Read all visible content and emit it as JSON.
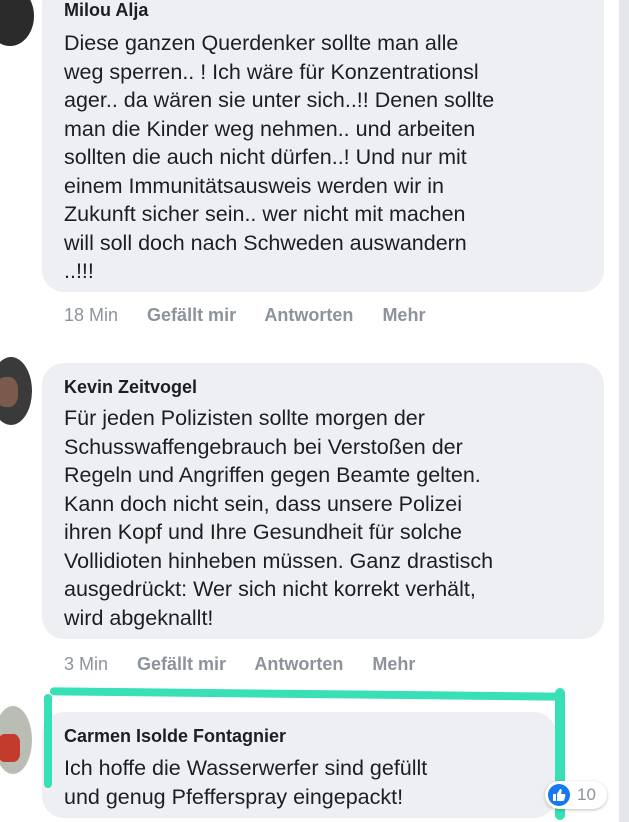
{
  "comments": [
    {
      "author": "Milou Alja",
      "text": "Diese ganzen Querdenker sollte man alle\nweg sperren.. ! Ich wäre für Konzentrationsl\nager.. da wären sie unter sich..!! Denen sollte\nman die Kinder weg nehmen.. und arbeiten\nsollten die auch nicht dürfen..! Und nur mit\neinem Immunitätsausweis werden wir in\nZukunft sicher sein.. wer nicht mit machen\nwill soll doch nach Schweden auswandern\n..!!!",
      "time": "18 Min",
      "actions": [
        "Gefällt mir",
        "Antworten",
        "Mehr"
      ]
    },
    {
      "author": "Kevin Zeitvogel",
      "text": "Für jeden Polizisten sollte morgen der\nSchusswaffengebrauch bei Verstoßen der\nRegeln und Angriffen gegen Beamte gelten.\nKann doch nicht sein, dass unsere Polizei\nihren Kopf und Ihre Gesundheit für solche\nVollidioten hinheben müssen. Ganz drastisch\nausgedrückt: Wer sich nicht korrekt verhält,\nwird abgeknallt!",
      "time": "3 Min",
      "actions": [
        "Gefällt mir",
        "Antworten",
        "Mehr"
      ]
    },
    {
      "author": "Carmen Isolde Fontagnier",
      "text": "Ich hoffe die Wasserwerfer sind gefüllt\nund genug Pfefferspray eingepackt!",
      "reaction_count": "10",
      "reaction_icon": "like-icon"
    }
  ],
  "colors": {
    "bubble": "#eeeff2",
    "highlight": "#38e0b6",
    "like": "#1877f2",
    "meta_text": "#8d939b"
  }
}
